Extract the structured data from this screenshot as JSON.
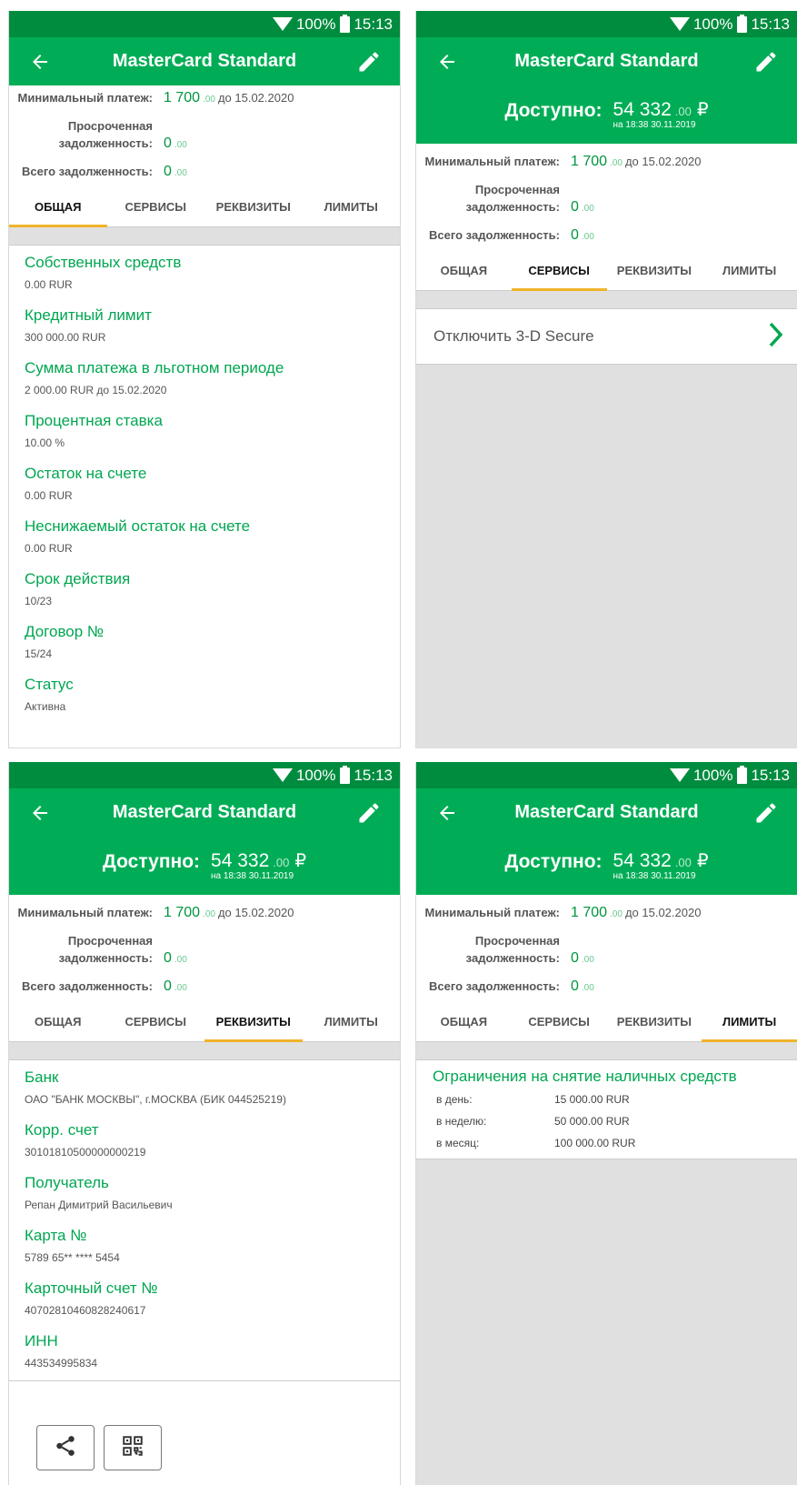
{
  "status": {
    "battery": "100%",
    "time": "15:13"
  },
  "app": {
    "title": "MasterCard Standard"
  },
  "available": {
    "label": "Доступно:",
    "int": "54 332",
    "dec": ".00",
    "currency": "₽",
    "ts": "на 18:38 30.11.2019"
  },
  "summary": {
    "min_label": "Минимальный платеж:",
    "min_int": "1 700",
    "min_dec": ".00",
    "min_due": "до 15.02.2020",
    "overdue_label1": "Просроченная",
    "overdue_label2": "задолженность:",
    "overdue_int": "0",
    "overdue_dec": ".00",
    "total_label": "Всего задолженность:",
    "total_int": "0",
    "total_dec": ".00"
  },
  "tabs": {
    "general": "ОБЩАЯ",
    "services": "СЕРВИСЫ",
    "requisites": "РЕКВИЗИТЫ",
    "limits": "ЛИМИТЫ"
  },
  "general": [
    {
      "title": "Собственных средств",
      "value": "0.00 RUR"
    },
    {
      "title": "Кредитный лимит",
      "value": "300 000.00 RUR"
    },
    {
      "title": "Сумма платежа в льготном периоде",
      "value": "2 000.00 RUR до 15.02.2020"
    },
    {
      "title": "Процентная ставка",
      "value": "10.00 %"
    },
    {
      "title": "Остаток на счете",
      "value": "0.00 RUR"
    },
    {
      "title": "Неснижаемый остаток на счете",
      "value": "0.00 RUR"
    },
    {
      "title": "Срок действия",
      "value": "10/23"
    },
    {
      "title": "Договор №",
      "value": "15/24"
    },
    {
      "title": "Статус",
      "value": "Активна"
    }
  ],
  "services": {
    "disable_3ds": "Отключить 3-D Secure"
  },
  "requisites": [
    {
      "title": "Банк",
      "value": "ОАО \"БАНК МОСКВЫ\", г.МОСКВА (БИК 044525219)"
    },
    {
      "title": "Корр. счет",
      "value": "30101810500000000219"
    },
    {
      "title": "Получатель",
      "value": "Репан Димитрий Васильевич"
    },
    {
      "title": "Карта №",
      "value": "5789 65** **** 5454"
    },
    {
      "title": "Карточный счет №",
      "value": "40702810460828240617"
    },
    {
      "title": "ИНН",
      "value": "443534995834"
    }
  ],
  "limits": {
    "title": "Ограничения на снятие наличных средств",
    "rows": [
      {
        "k": "в день:",
        "v": "15 000.00 RUR"
      },
      {
        "k": "в неделю:",
        "v": "50 000.00 RUR"
      },
      {
        "k": "в месяц:",
        "v": "100 000.00 RUR"
      }
    ]
  },
  "colors": {
    "status_bar": "#008c3f",
    "app_bar": "#00ad56",
    "accent_text": "#00a651",
    "tab_indicator": "#f0b42a"
  }
}
